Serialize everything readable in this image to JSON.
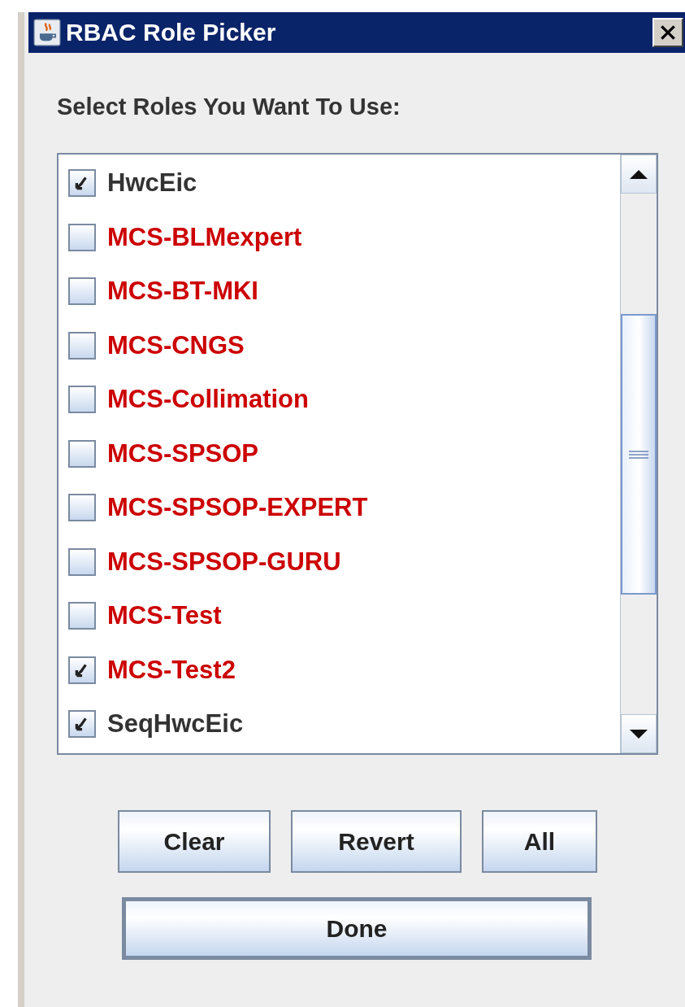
{
  "window": {
    "title": "RBAC Role Picker"
  },
  "prompt": "Select Roles You Want To Use:",
  "roles": [
    {
      "name": "HwcEic",
      "checked": true,
      "color": "#333333"
    },
    {
      "name": "MCS-BLMexpert",
      "checked": false,
      "color": "#cc0000"
    },
    {
      "name": "MCS-BT-MKI",
      "checked": false,
      "color": "#cc0000"
    },
    {
      "name": "MCS-CNGS",
      "checked": false,
      "color": "#cc0000"
    },
    {
      "name": "MCS-Collimation",
      "checked": false,
      "color": "#cc0000"
    },
    {
      "name": "MCS-SPSOP",
      "checked": false,
      "color": "#cc0000"
    },
    {
      "name": "MCS-SPSOP-EXPERT",
      "checked": false,
      "color": "#cc0000"
    },
    {
      "name": "MCS-SPSOP-GURU",
      "checked": false,
      "color": "#cc0000"
    },
    {
      "name": "MCS-Test",
      "checked": false,
      "color": "#cc0000"
    },
    {
      "name": "MCS-Test2",
      "checked": true,
      "color": "#cc0000"
    },
    {
      "name": "SeqHwcEic",
      "checked": true,
      "color": "#333333"
    }
  ],
  "buttons": [
    "Clear",
    "Revert",
    "All"
  ],
  "done_button": "Done"
}
